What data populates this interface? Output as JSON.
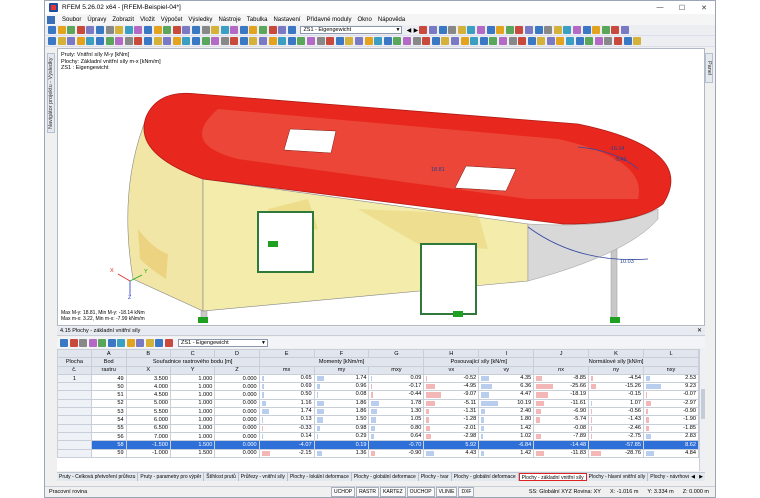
{
  "window": {
    "title": "RFEM 5.26.02 x64 - [RFEM-Beispiel-04*]",
    "buttons": [
      "—",
      "☐",
      "✕"
    ]
  },
  "menu": [
    "Soubor",
    "Úpravy",
    "Zobrazit",
    "Vložit",
    "Výpočet",
    "Výsledky",
    "Nástroje",
    "Tabulka",
    "Nastavení",
    "Přídavné moduly",
    "Okno",
    "Nápověda"
  ],
  "toolbar": {
    "load_case": "ZS1 - Eigengewicht"
  },
  "side_tabs": {
    "left": "Navigátor projektu - Výsledky",
    "right": "Panel"
  },
  "viewport": {
    "info_lines": [
      "Pruty: Vnitřní síly M-y [kNm]",
      "Plochy: Základní vnitřní síly m-x [kNm/m]",
      "ZS1 : Eigengewicht"
    ],
    "stats_lines": [
      "Max M-y: 18.81, Min M-y: -18.14 kNm",
      "Max m-x: 3.22, Min m-x: -7.99 kNm/m"
    ],
    "labels": {
      "l1": "18.81",
      "l2": "-16.14",
      "l3": "-9.42",
      "l4": "10.03"
    },
    "axes": {
      "x": "X",
      "y": "Y",
      "z": "Z"
    }
  },
  "panel": {
    "title": "4.15 Plochy - základní vnitřní síly",
    "load_case": "ZS1 - Eigengewicht",
    "close": "✕"
  },
  "table": {
    "col_letters": [
      "A",
      "B",
      "C",
      "D",
      "E",
      "F",
      "G",
      "H",
      "I",
      "J",
      "K",
      "L"
    ],
    "head1": {
      "plocha": "Plocha",
      "bod": "Bod",
      "souradnice": "Souřadnice rastrového bodu [m]",
      "momenty": "Momenty [kNm/m]",
      "posouvajici": "Posouvající síly [kN/m]",
      "normalove": "Normálové síly [kN/m]"
    },
    "head2": [
      "č.",
      "rastru",
      "X",
      "Y",
      "Z",
      "mx",
      "my",
      "mxy",
      "vx",
      "vy",
      "nx",
      "ny",
      "nxy"
    ],
    "rows": [
      [
        "1",
        "49",
        "3.500",
        "1.000",
        "0.000",
        "0.65",
        "1.74",
        "0.09",
        "-0.52",
        "4.35",
        "-8.85",
        "-4.54",
        "2.53"
      ],
      [
        "",
        "50",
        "4.000",
        "1.000",
        "0.000",
        "0.69",
        "0.96",
        "-0.17",
        "-4.95",
        "6.36",
        "-25.66",
        "-15.26",
        "9.23"
      ],
      [
        "",
        "51",
        "4.500",
        "1.000",
        "0.000",
        "0.50",
        "0.08",
        "-0.44",
        "-9.07",
        "4.47",
        "-18.19",
        "-0.15",
        "-0.07"
      ],
      [
        "",
        "52",
        "5.000",
        "1.000",
        "0.000",
        "1.16",
        "1.86",
        "1.78",
        "-5.11",
        "10.19",
        "-11.61",
        "1.07",
        "-2.97"
      ],
      [
        "",
        "53",
        "5.500",
        "1.000",
        "0.000",
        "1.74",
        "1.86",
        "1.30",
        "-1.31",
        "2.40",
        "-6.90",
        "-0.56",
        "-0.90"
      ],
      [
        "",
        "54",
        "6.000",
        "1.000",
        "0.000",
        "0.13",
        "1.50",
        "1.05",
        "-1.28",
        "1.80",
        "-5.74",
        "-1.43",
        "-1.90"
      ],
      [
        "",
        "55",
        "6.500",
        "1.000",
        "0.000",
        "-0.33",
        "0.98",
        "0.80",
        "-2.01",
        "1.42",
        "-0.08",
        "-2.46",
        "-1.85"
      ],
      [
        "",
        "56",
        "7.000",
        "1.000",
        "0.000",
        "0.14",
        "0.29",
        "0.64",
        "-2.98",
        "1.02",
        "-7.89",
        "-2.75",
        "2.83"
      ],
      [
        "",
        "58",
        "-1.500",
        "1.500",
        "0.000",
        "-4.07",
        "0.19",
        "-0.70",
        "5.92",
        "-6.84",
        "-14.48",
        "-57.85",
        "8.62"
      ],
      [
        "",
        "59",
        "-1.000",
        "1.500",
        "0.000",
        "-2.15",
        "1.36",
        "-0.90",
        "4.43",
        "1.42",
        "-11.83",
        "-28.76",
        "4.84"
      ]
    ],
    "selected_row": 8
  },
  "bottom_tabs": [
    "Pruty - Celková přetvoření průřezu",
    "Pruty - parametry pro výpěr",
    "Štíhlost prutů",
    "Průřezy - vnitřní síly",
    "Plochy - lokální deformace",
    "Plochy - globální deformace",
    "Plochy - tvar",
    "Plochy - globální deformace",
    "Plochy - základní vnitřní síly",
    "Plochy - hlavní vnitřní síly",
    "Plochy - návrhové vnitřní síly"
  ],
  "active_bottom_tab": 8,
  "statusbar": {
    "left": "Pracovní rovina",
    "buttons": [
      "UCHOP",
      "RASTR",
      "KARTEZ",
      "OUCHOP",
      "VLINIE",
      "DXF"
    ],
    "coords": [
      "SS: Globální XYZ  Rovina: XY",
      "X: -1.016 m",
      "Y: 3.334 m",
      "Z: 0.000 m"
    ]
  },
  "colors": {
    "red": "#e8281e",
    "yellow": "#f3ecaa",
    "selection": "#2f6fd8"
  }
}
